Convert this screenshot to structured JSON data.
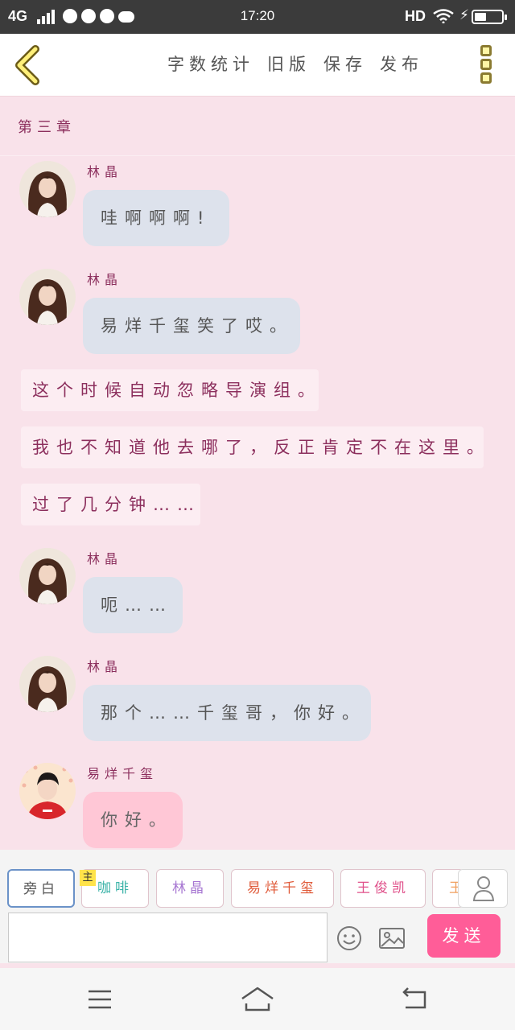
{
  "status_bar": {
    "network": "4G",
    "time": "17:20",
    "hd": "HD",
    "icons": [
      "signal-icon",
      "wechat-icon",
      "qq-icon",
      "qq-icon",
      "cloud-icon",
      "wifi-icon",
      "charging-icon",
      "battery-icon"
    ],
    "battery_level": 0.45
  },
  "toolbar": {
    "back_icon": "chevron-left-icon",
    "actions": [
      "字数统计",
      "旧版",
      "保存",
      "发布"
    ],
    "more_icon": "more-vertical-icon"
  },
  "chapter": {
    "title": "第三章"
  },
  "messages": [
    {
      "type": "dialog",
      "speaker": "林晶",
      "text": "哇啊啊啊!",
      "style": "gray",
      "avatar": "girl-avatar"
    },
    {
      "type": "dialog",
      "speaker": "林晶",
      "text": "易烊千玺笑了哎。",
      "style": "gray",
      "avatar": "girl-avatar"
    },
    {
      "type": "narration",
      "text": "这个时候自动忽略导演组。"
    },
    {
      "type": "narration",
      "text": "我也不知道他去哪了，反正肯定不在这里。"
    },
    {
      "type": "narration",
      "text": "过了几分钟……"
    },
    {
      "type": "dialog",
      "speaker": "林晶",
      "text": "呃……",
      "style": "gray",
      "avatar": "girl-avatar"
    },
    {
      "type": "dialog",
      "speaker": "林晶",
      "text": "那个……千玺哥，你好。",
      "style": "gray",
      "avatar": "girl-avatar"
    },
    {
      "type": "dialog",
      "speaker": "易烊千玺",
      "text": "你好。",
      "style": "pink",
      "avatar": "boy-avatar"
    }
  ],
  "characters": [
    {
      "label": "旁白",
      "color": "#555555",
      "selected": true
    },
    {
      "label": "咖啡",
      "color": "#3bb3a8",
      "main_tag": "主"
    },
    {
      "label": "林晶",
      "color": "#a777d2"
    },
    {
      "label": "易烊千玺",
      "color": "#e05b3a"
    },
    {
      "label": "王俊凯",
      "color": "#e0508a"
    },
    {
      "label": "王",
      "color": "#f0a060"
    }
  ],
  "input": {
    "placeholder": "",
    "emoji_icon": "smiley-icon",
    "image_icon": "image-icon",
    "user_icon": "user-icon",
    "send_label": "发送"
  },
  "nav_bar": {
    "icons": [
      "menu-icon",
      "home-icon",
      "back-icon"
    ]
  }
}
